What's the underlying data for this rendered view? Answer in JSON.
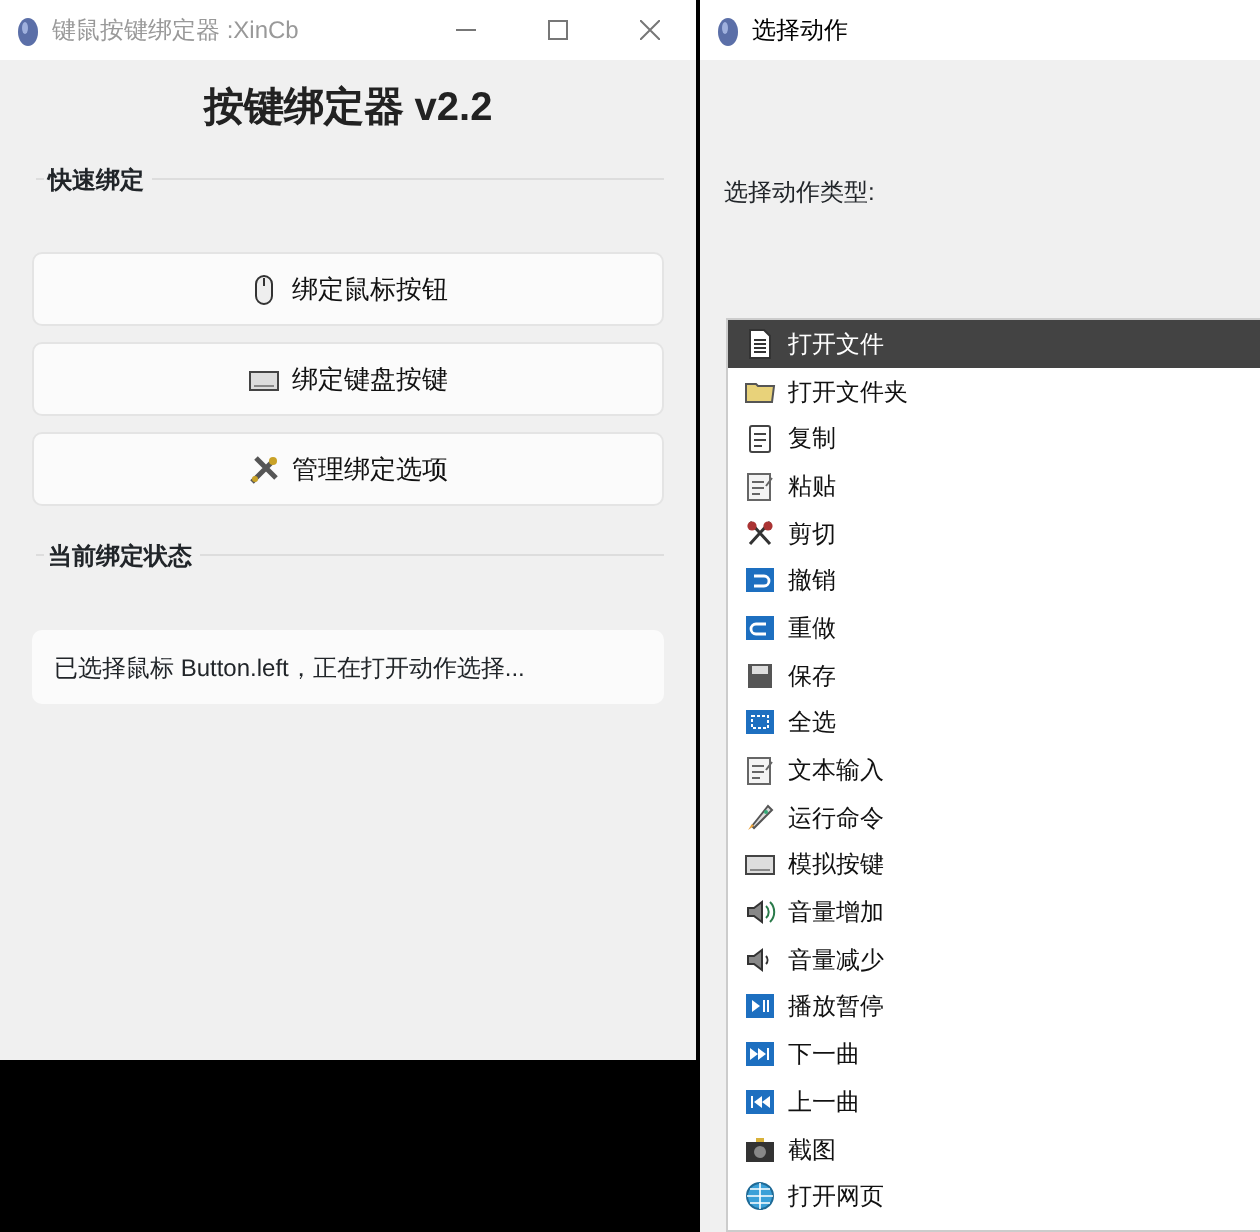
{
  "main_window": {
    "title": "键鼠按键绑定器 :XinCb",
    "active": false,
    "heading": "按键绑定器 v2.2",
    "quick_bind": {
      "label": "快速绑定",
      "buttons": [
        "绑定鼠标按钮",
        "绑定键盘按键",
        "管理绑定选项"
      ]
    },
    "status": {
      "label": "当前绑定状态",
      "text": "已选择鼠标 Button.left，正在打开动作选择..."
    }
  },
  "action_window": {
    "title": "选择动作",
    "active": true,
    "prompt": "选择动作类型:",
    "actions": [
      {
        "label": "打开文件",
        "selected": true
      },
      {
        "label": "打开文件夹",
        "selected": false
      },
      {
        "label": "复制",
        "selected": false
      },
      {
        "label": "粘贴",
        "selected": false
      },
      {
        "label": "剪切",
        "selected": false
      },
      {
        "label": "撤销",
        "selected": false
      },
      {
        "label": "重做",
        "selected": false
      },
      {
        "label": "保存",
        "selected": false
      },
      {
        "label": "全选",
        "selected": false
      },
      {
        "label": "文本输入",
        "selected": false
      },
      {
        "label": "运行命令",
        "selected": false
      },
      {
        "label": "模拟按键",
        "selected": false
      },
      {
        "label": "音量增加",
        "selected": false
      },
      {
        "label": "音量减少",
        "selected": false
      },
      {
        "label": "播放暂停",
        "selected": false
      },
      {
        "label": "下一曲",
        "selected": false
      },
      {
        "label": "上一曲",
        "selected": false
      },
      {
        "label": "截图",
        "selected": false
      },
      {
        "label": "打开网页",
        "selected": false
      }
    ]
  }
}
